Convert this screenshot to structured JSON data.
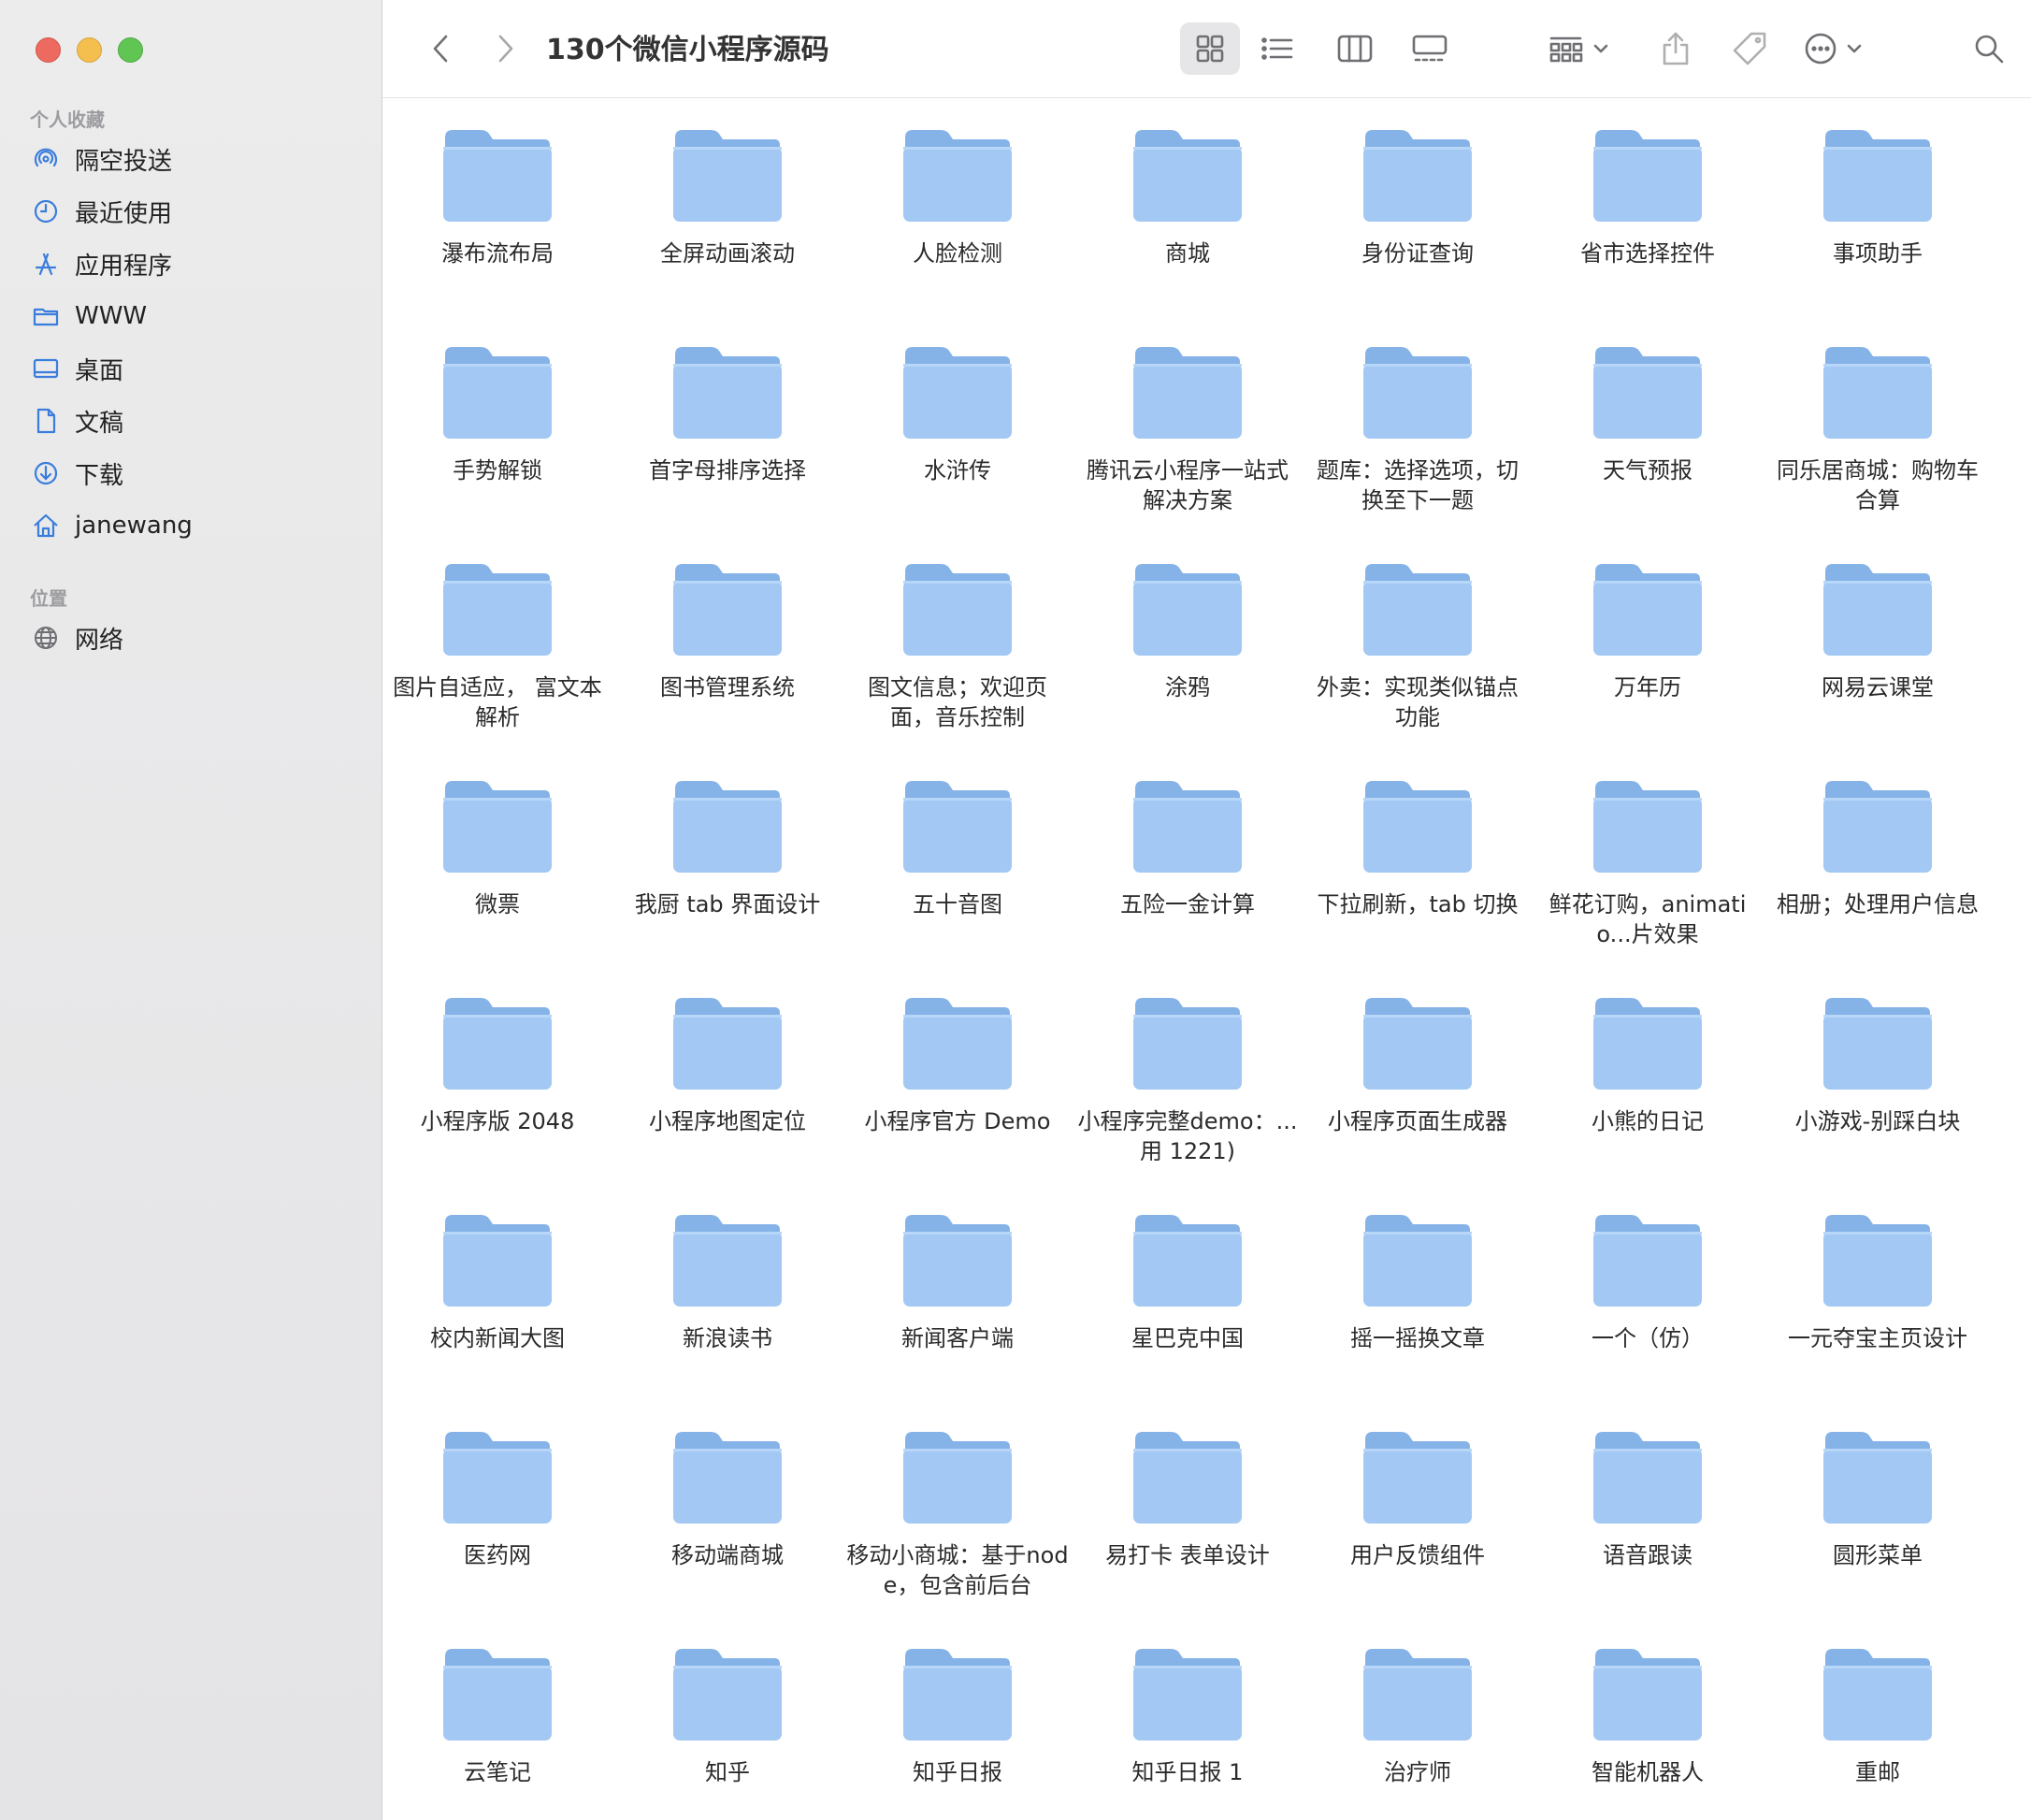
{
  "window": {
    "title": "130个微信小程序源码"
  },
  "sidebar": {
    "favorites_header": "个人收藏",
    "favorites": [
      {
        "label": "隔空投送",
        "icon": "airdrop-icon"
      },
      {
        "label": "最近使用",
        "icon": "clock-icon"
      },
      {
        "label": "应用程序",
        "icon": "applications-icon"
      },
      {
        "label": "WWW",
        "icon": "folder-icon"
      },
      {
        "label": "桌面",
        "icon": "desktop-icon"
      },
      {
        "label": "文稿",
        "icon": "document-icon"
      },
      {
        "label": "下载",
        "icon": "download-icon"
      },
      {
        "label": "janewang",
        "icon": "home-icon"
      }
    ],
    "locations_header": "位置",
    "locations": [
      {
        "label": "网络",
        "icon": "globe-icon"
      }
    ]
  },
  "toolbar": {
    "back": "chevron-left-icon",
    "forward": "chevron-right-icon",
    "view_icons": "icon-view-icon",
    "view_list": "list-view-icon",
    "view_columns": "column-view-icon",
    "view_gallery": "gallery-view-icon",
    "group": "group-icon",
    "share": "share-icon",
    "tag": "tag-icon",
    "more": "ellipsis-circle-icon",
    "search": "search-icon"
  },
  "folders": [
    "瀑布流布局",
    "全屏动画滚动",
    "人脸检测",
    "商城",
    "身份证查询",
    "省市选择控件",
    "事项助手",
    "手势解锁",
    "首字母排序选择",
    "水浒传",
    "腾讯云小程序一站式解决方案",
    "题库：选择选项，切换至下一题",
    "天气预报",
    "同乐居商城：购物车合算",
    "图片自适应， 富文本解析",
    "图书管理系统",
    "图文信息；欢迎页面，音乐控制",
    "涂鸦",
    "外卖：实现类似锚点功能",
    "万年历",
    "网易云课堂",
    "微票",
    "我厨 tab 界面设计",
    "五十音图",
    "五险一金计算",
    "下拉刷新，tab 切换",
    "鲜花订购，animatio...片效果",
    "相册；处理用户信息",
    "小程序版 2048",
    "小程序地图定位",
    "小程序官方 Demo",
    "小程序完整demo：...用 1221)",
    "小程序页面生成器",
    "小熊的日记",
    "小游戏-别踩白块",
    "校内新闻大图",
    "新浪读书",
    "新闻客户端",
    "星巴克中国",
    "摇一摇换文章",
    "一个（仿）",
    "一元夺宝主页设计",
    "医药网",
    "移动端商城",
    "移动小商城：基于node，包含前后台",
    "易打卡 表单设计",
    "用户反馈组件",
    "语音跟读",
    "圆形菜单",
    "云笔记",
    "知乎",
    "知乎日报",
    "知乎日报 1",
    "治疗师",
    "智能机器人",
    "重邮"
  ],
  "colors": {
    "folder_body": "#a2c8f3",
    "folder_tab": "#85b3e8",
    "sidebar_icon": "#3a7ddc"
  }
}
